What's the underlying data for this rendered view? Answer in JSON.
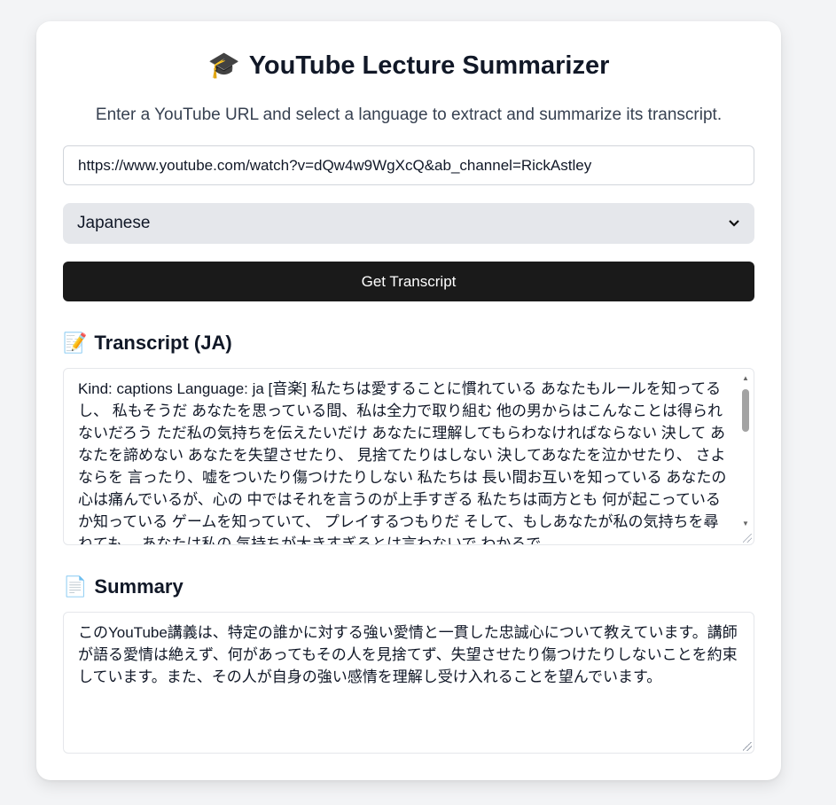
{
  "header": {
    "icon": "graduation-cap-icon",
    "icon_glyph": "🎓",
    "title": "YouTube Lecture Summarizer",
    "subtitle": "Enter a YouTube URL and select a language to extract and summarize its transcript."
  },
  "form": {
    "url_value": "https://www.youtube.com/watch?v=dQw4w9WgXcQ&ab_channel=RickAstley",
    "language_selected": "Japanese",
    "submit_label": "Get Transcript"
  },
  "transcript": {
    "icon": "memo-icon",
    "icon_glyph": "📝",
    "heading": "Transcript (JA)",
    "text": "Kind: captions Language: ja [音楽] 私たちは愛することに慣れている あなたもルールを知ってるし、 私もそうだ あなたを思っている間、私は全力で取り組む 他の男からはこんなことは得られないだろう ただ私の気持ちを伝えたいだけ あなたに理解してもらわなければならない 決して あなたを諦めない あなたを失望させたり、 見捨てたりはしない 決してあなたを泣かせたり、 さよならを 言ったり、嘘をついたり傷つけたりしない 私たちは 長い間お互いを知っている あなたの心は痛んでいるが、心の 中ではそれを言うのが上手すぎる 私たちは両方とも 何が起こっているか知っている ゲームを知っていて、 プレイするつもりだ そして、もしあなたが私の気持ちを尋ねても、 あなたは私の 気持ちが大きすぎるとは言わないで わかるで"
  },
  "summary": {
    "icon": "page-icon",
    "icon_glyph": "📄",
    "heading": "Summary",
    "text": "このYouTube講義は、特定の誰かに対する強い愛情と一貫した忠誠心について教えています。講師が語る愛情は絶えず、何があってもその人を見捨てず、失望させたり傷つけたりしないことを約束しています。また、その人が自身の強い感情を理解し受け入れることを望んでいます。"
  },
  "colors": {
    "button_bg": "#1a1a1a",
    "select_bg": "#e5e7eb",
    "page_bg": "#f3f4f6"
  }
}
